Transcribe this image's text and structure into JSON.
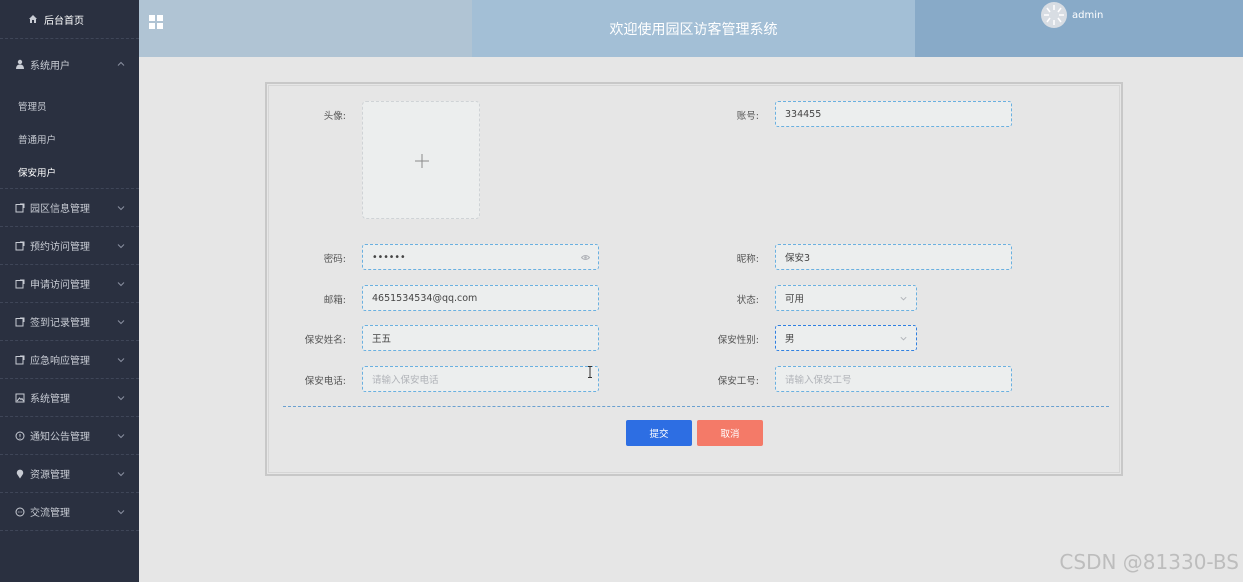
{
  "sidebar": {
    "home_label": "后台首页",
    "system_user": {
      "label": "系统用户",
      "children": [
        "管理员",
        "普通用户",
        "保安用户"
      ],
      "active_child": "保安用户"
    },
    "menus": [
      {
        "label": "园区信息管理",
        "icon": "doc-edit-icon"
      },
      {
        "label": "预约访问管理",
        "icon": "doc-edit-icon"
      },
      {
        "label": "申请访问管理",
        "icon": "doc-edit-icon"
      },
      {
        "label": "签到记录管理",
        "icon": "doc-edit-icon"
      },
      {
        "label": "应急响应管理",
        "icon": "doc-edit-icon"
      },
      {
        "label": "系统管理",
        "icon": "picture-icon"
      },
      {
        "label": "通知公告管理",
        "icon": "info-circle-icon"
      },
      {
        "label": "资源管理",
        "icon": "location-icon"
      },
      {
        "label": "交流管理",
        "icon": "chat-icon"
      }
    ]
  },
  "header": {
    "title": "欢迎使用园区访客管理系统",
    "username": "admin"
  },
  "form": {
    "avatar_label": "头像:",
    "account_label": "账号:",
    "account_value": "334455",
    "password_label": "密码:",
    "password_value": "••••••",
    "nickname_label": "昵称:",
    "nickname_value": "保安3",
    "email_label": "邮箱:",
    "email_value": "4651534534@qq.com",
    "status_label": "状态:",
    "status_value": "可用",
    "guard_name_label": "保安姓名:",
    "guard_name_value": "王五",
    "guard_gender_label": "保安性别:",
    "guard_gender_value": "男",
    "guard_phone_label": "保安电话:",
    "guard_phone_placeholder": "请输入保安电话",
    "guard_id_label": "保安工号:",
    "guard_id_placeholder": "请输入保安工号",
    "submit_label": "提交",
    "cancel_label": "取消"
  },
  "watermark": "CSDN @81330-BS",
  "colors": {
    "sidebar_bg": "#2a3040",
    "submit": "#2d6ee3",
    "cancel": "#f47a68",
    "field_border": "#6ab0e0"
  }
}
